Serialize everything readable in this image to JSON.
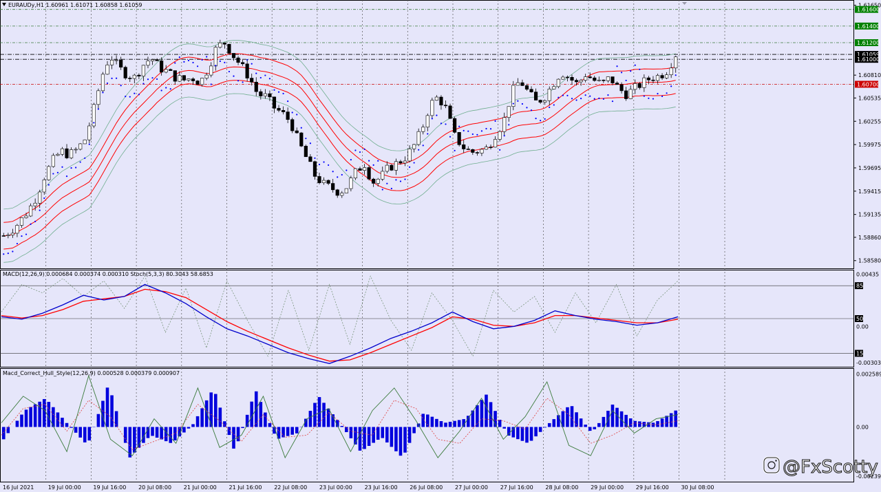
{
  "header": {
    "symbol_line": "EURAUDy,H1  1.60961 1.61071 1.60858 1.61059"
  },
  "colors": {
    "background": "#e6e6fa",
    "bull_candle": "#ffffff",
    "bear_candle": "#000000",
    "keltner": "#ff0000",
    "bollinger": "#6fae8f",
    "sar_dots": "#0000ff",
    "macd_main": "#0000cc",
    "macd_signal": "#ff0000",
    "stoch_main": "#6a8a6a",
    "histogram": "#0000dd",
    "price_tag_black": "#000000",
    "price_tag_green": "#008000",
    "price_tag_red": "#cc0000"
  },
  "watermark": {
    "text": "@FxScotty",
    "icon": "instagram-camera-icon"
  },
  "chart_data": [
    {
      "pane": "price",
      "type": "candlestick",
      "title": "EURAUDy,H1  1.60961 1.61071 1.60858 1.61059",
      "y_ticks": [
        1.6165,
        1.6081,
        1.60535,
        1.60255,
        1.59975,
        1.59695,
        1.59415,
        1.59135,
        1.5886,
        1.5858
      ],
      "ylim": [
        1.5852,
        1.6168
      ],
      "price_tags": [
        {
          "label": "1.61600",
          "value": 1.616,
          "color": "green"
        },
        {
          "label": "1.61400",
          "value": 1.614,
          "color": "green"
        },
        {
          "label": "1.61200",
          "value": 1.612,
          "color": "green"
        },
        {
          "label": "1.61059",
          "value": 1.61059,
          "color": "black"
        },
        {
          "label": "1.61000",
          "value": 1.61,
          "color": "black"
        },
        {
          "label": "1.60700",
          "value": 1.607,
          "color": "red"
        }
      ],
      "x_labels": [
        "16 Jul 2021",
        "19 Jul 00:00",
        "19 Jul 16:00",
        "20 Jul 08:00",
        "21 Jul 00:00",
        "21 Jul 16:00",
        "22 Jul 08:00",
        "23 Jul 00:00",
        "23 Jul 16:00",
        "26 Jul 08:00",
        "27 Jul 00:00",
        "27 Jul 16:00",
        "28 Jul 08:00",
        "29 Jul 00:00",
        "29 Jul 16:00",
        "30 Jul 08:00"
      ],
      "close_path": [
        1.5888,
        1.5895,
        1.5905,
        1.5918,
        1.5935,
        1.596,
        1.5978,
        1.599,
        1.5985,
        1.5992,
        1.6005,
        1.604,
        1.608,
        1.6105,
        1.609,
        1.6082,
        1.6078,
        1.6093,
        1.6102,
        1.609,
        1.6085,
        1.6078,
        1.6075,
        1.6078,
        1.6072,
        1.609,
        1.6115,
        1.612,
        1.6105,
        1.6092,
        1.6078,
        1.6058,
        1.6055,
        1.6042,
        1.6035,
        1.6025,
        1.6,
        1.598,
        1.596,
        1.595,
        1.5945,
        1.594,
        1.5948,
        1.5965,
        1.5975,
        1.5952,
        1.5958,
        1.597,
        1.5975,
        1.5982,
        1.5995,
        1.6015,
        1.6045,
        1.6055,
        1.604,
        1.6008,
        1.5995,
        1.5988,
        1.599,
        1.5993,
        1.601,
        1.6025,
        1.606,
        1.6075,
        1.606,
        1.6048,
        1.6055,
        1.607,
        1.6085,
        1.6078,
        1.607,
        1.6082,
        1.6075,
        1.607,
        1.6078,
        1.6065,
        1.6058,
        1.6065,
        1.6072,
        1.6078,
        1.608,
        1.6087,
        1.6106
      ]
    },
    {
      "pane": "oscillator",
      "type": "line",
      "title": "MACD(12,26,9) 0.000684 0.000374 0.000310  Stoch(5,3,3) 80.3043 58.6853",
      "y_ticks": [
        0.00435,
        0.0,
        -0.003038
      ],
      "ylim": [
        -0.0032,
        0.0045
      ],
      "levels": [
        {
          "label": "85",
          "value": 0.0034
        },
        {
          "label": "50",
          "value": 0.00065
        },
        {
          "label": "15",
          "value": -0.00225
        }
      ],
      "series": [
        {
          "name": "MACD",
          "values": [
            0.0008,
            0.0006,
            0.0011,
            0.0018,
            0.0026,
            0.0022,
            0.0025,
            0.0035,
            0.0028,
            0.0019,
            0.0008,
            -0.0002,
            -0.0008,
            -0.0015,
            -0.0022,
            -0.0027,
            -0.0031,
            -0.0025,
            -0.0018,
            -0.001,
            -0.0004,
            0.0003,
            0.0012,
            0.0004,
            -0.0002,
            0.0,
            0.0005,
            0.0013,
            0.0009,
            0.0006,
            0.0004,
            0.0001,
            0.0003,
            0.0008
          ]
        },
        {
          "name": "Signal",
          "values": [
            0.0009,
            0.0007,
            0.0009,
            0.0014,
            0.0021,
            0.0023,
            0.0025,
            0.0031,
            0.0029,
            0.0024,
            0.0014,
            0.0004,
            -0.0004,
            -0.0011,
            -0.0018,
            -0.0024,
            -0.0029,
            -0.0028,
            -0.0022,
            -0.0015,
            -0.0008,
            -0.0001,
            0.0008,
            0.0006,
            0.0001,
            0.0,
            0.0003,
            0.0009,
            0.0009,
            0.0007,
            0.0005,
            0.0003,
            0.0003,
            0.0006
          ]
        },
        {
          "name": "Stoch",
          "values": [
            0.0012,
            0.0035,
            0.0028,
            0.004,
            0.0025,
            0.0038,
            0.0015,
            0.0042,
            -0.0005,
            0.0032,
            -0.0018,
            0.0038,
            0.0005,
            -0.0025,
            0.003,
            -0.002,
            0.0035,
            -0.0015,
            0.0042,
            0.0005,
            -0.002,
            0.0028,
            0.0005,
            -0.0025,
            0.003,
            0.0012,
            0.0025,
            -0.0005,
            0.0028,
            0.0003,
            0.0035,
            -0.0008,
            0.0022,
            0.0038
          ]
        }
      ]
    },
    {
      "pane": "histogram",
      "type": "bar",
      "title": "Macd_Correct_Hull_Style(12,26,9) 0.000528 0.000379 0.000907",
      "y_ticks": [
        0.002589,
        0.0,
        -0.002392
      ],
      "ylim": [
        -0.0026,
        0.0027
      ],
      "bars": [
        -0.0006,
        0.0008,
        0.0014,
        0.0002,
        -0.0009,
        0.0021,
        -0.0015,
        -0.0004,
        -0.0008,
        0.0001,
        0.0019,
        -0.0012,
        0.0018,
        -0.0006,
        -0.0003,
        0.0015,
        0.0002,
        -0.0012,
        -0.0005,
        -0.0015,
        0.0007,
        0.0002,
        0.0004,
        0.0016,
        -0.0004,
        -0.0008,
        0.0002,
        0.0011,
        -0.0003,
        0.0011,
        0.0003,
        0.0002,
        0.0008
      ],
      "series": [
        {
          "name": "Hull main",
          "values": [
            0.0002,
            0.0015,
            0.0008,
            -0.0012,
            0.0025,
            -0.0006,
            -0.0014,
            0.0004,
            -0.0008,
            0.0019,
            -0.001,
            -0.0004,
            0.0015,
            -0.0015,
            0.0004,
            0.0009,
            -0.0012,
            0.0008,
            0.0019,
            0.0003,
            -0.0015,
            -0.0002,
            0.0014,
            -0.0006,
            0.0005,
            0.0022,
            -0.0009,
            -0.0014,
            0.0008,
            -0.0003,
            0.0004,
            0.0006
          ]
        },
        {
          "name": "Hull signal",
          "values": [
            -0.0004,
            0.0009,
            0.0011,
            -0.0002,
            0.0013,
            0.0005,
            -0.0011,
            -0.0007,
            -0.0003,
            0.0011,
            0.0003,
            -0.0007,
            0.0006,
            -0.0005,
            -0.0004,
            0.0007,
            -0.0002,
            -0.0004,
            0.0013,
            0.0009,
            -0.0006,
            -0.0008,
            0.0004,
            0.0003,
            -0.0001,
            0.0014,
            0.0006,
            -0.0008,
            -0.0004,
            0.0002,
            0.0001,
            0.0003
          ]
        }
      ]
    }
  ]
}
